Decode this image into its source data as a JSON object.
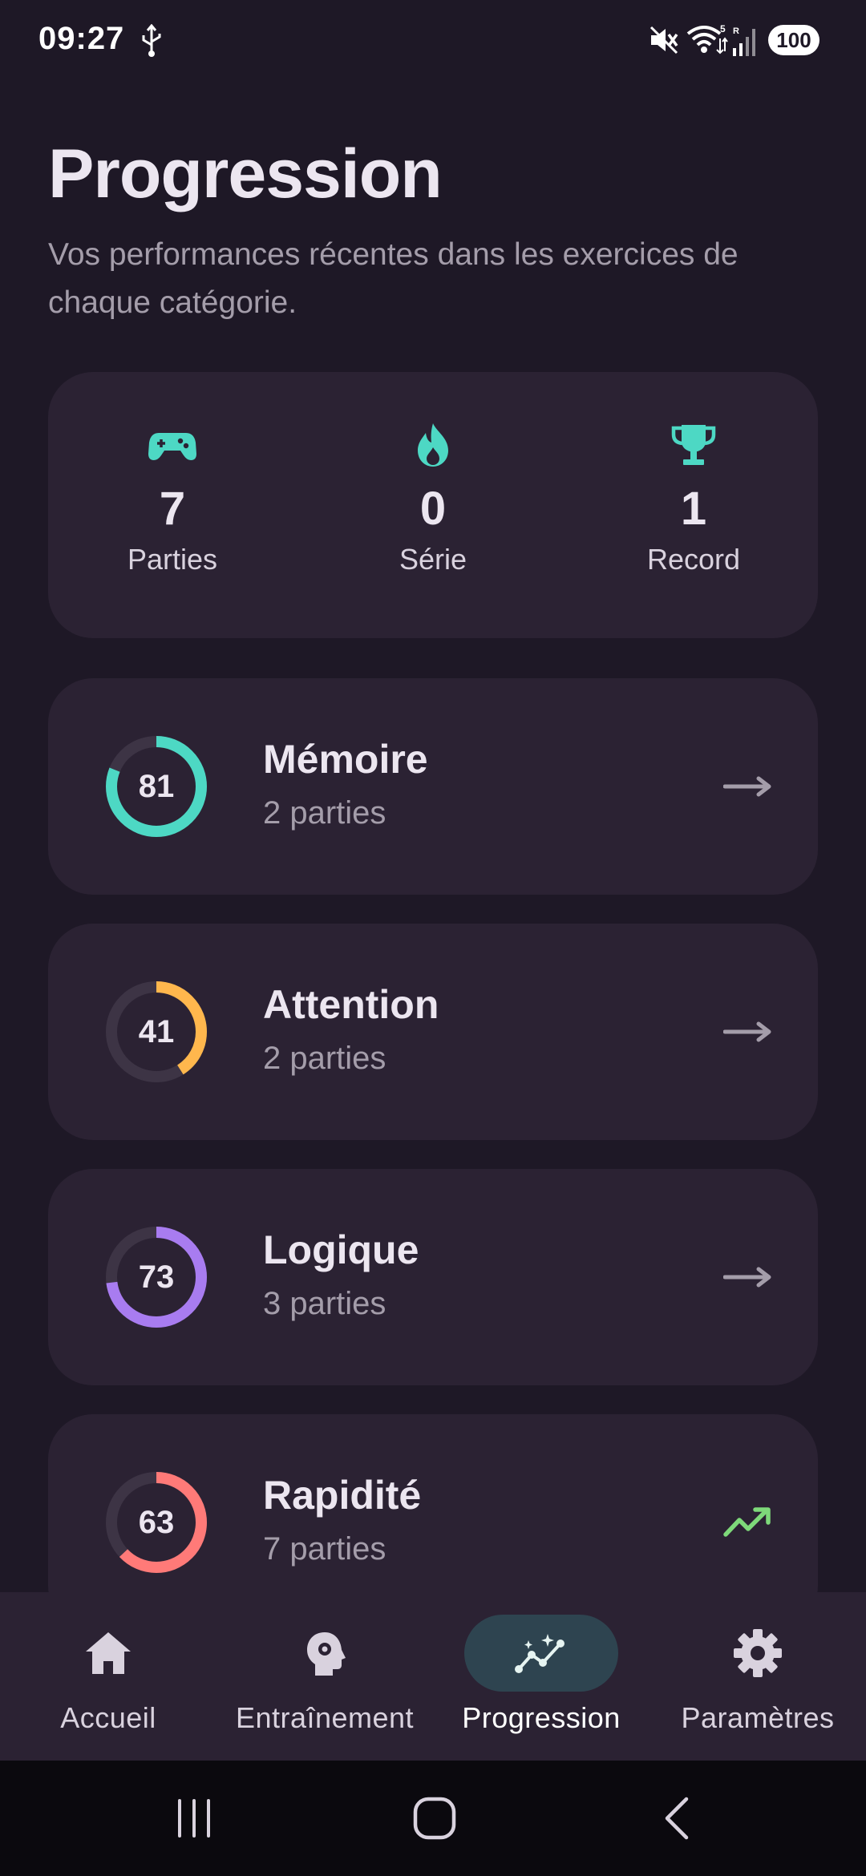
{
  "status_bar": {
    "time": "09:27",
    "battery": "100"
  },
  "header": {
    "title": "Progression",
    "subtitle": "Vos performances récentes dans les exercices de chaque catégorie."
  },
  "stats": [
    {
      "icon": "gamepad-icon",
      "value": "7",
      "label": "Parties"
    },
    {
      "icon": "flame-icon",
      "value": "0",
      "label": "Série"
    },
    {
      "icon": "trophy-icon",
      "value": "1",
      "label": "Record"
    }
  ],
  "accent_color": "#4dd8c4",
  "categories": [
    {
      "name": "Mémoire",
      "score": "81",
      "score_fraction": 0.81,
      "games": "2 parties",
      "color": "#4dd8c4",
      "trend": "arrow-right-icon"
    },
    {
      "name": "Attention",
      "score": "41",
      "score_fraction": 0.41,
      "games": "2 parties",
      "color": "#ffb74d",
      "trend": "arrow-right-icon"
    },
    {
      "name": "Logique",
      "score": "73",
      "score_fraction": 0.73,
      "games": "3 parties",
      "color": "#a87cf0",
      "trend": "arrow-right-icon"
    },
    {
      "name": "Rapidité",
      "score": "63",
      "score_fraction": 0.63,
      "games": "7 parties",
      "color": "#ff7a78",
      "trend": "trending-up-icon",
      "trend_color": "#7ed97a"
    }
  ],
  "bottom_nav": {
    "items": [
      {
        "label": "Accueil",
        "icon": "home-icon"
      },
      {
        "label": "Entraînement",
        "icon": "brain-head-icon"
      },
      {
        "label": "Progression",
        "icon": "insights-icon",
        "active": true
      },
      {
        "label": "Paramètres",
        "icon": "gear-icon"
      }
    ]
  }
}
